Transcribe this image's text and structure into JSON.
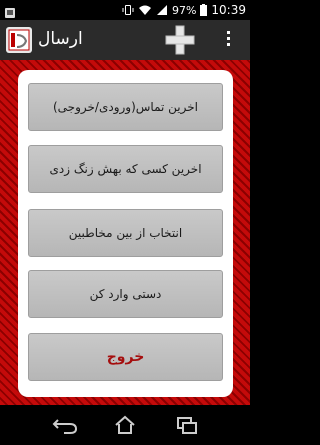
{
  "status_bar": {
    "battery_percent": "97%",
    "time": "10:39",
    "icons": [
      "notification-icon",
      "signal-icon",
      "wifi-icon",
      "battery-icon"
    ]
  },
  "action_bar": {
    "title": "ارسال",
    "icons": [
      "app-logo-icon",
      "add-icon",
      "overflow-menu-icon"
    ]
  },
  "menu": {
    "buttons": [
      {
        "label": "اخرین تماس(ورودی/خروجی)"
      },
      {
        "label": "اخرین کسی که بهش زنگ زدی"
      },
      {
        "label": "انتخاب از بین مخاطبین"
      },
      {
        "label": "دستی وارد کن"
      },
      {
        "label": "خروج"
      }
    ]
  },
  "nav_bar": {
    "icons": [
      "back-icon",
      "home-icon",
      "recent-apps-icon"
    ]
  },
  "colors": {
    "background_stripe_primary": "#c40a0a",
    "background_stripe_secondary": "#8c0000",
    "exit_text": "#a50e0e",
    "action_bar": "#2b2b2b"
  }
}
